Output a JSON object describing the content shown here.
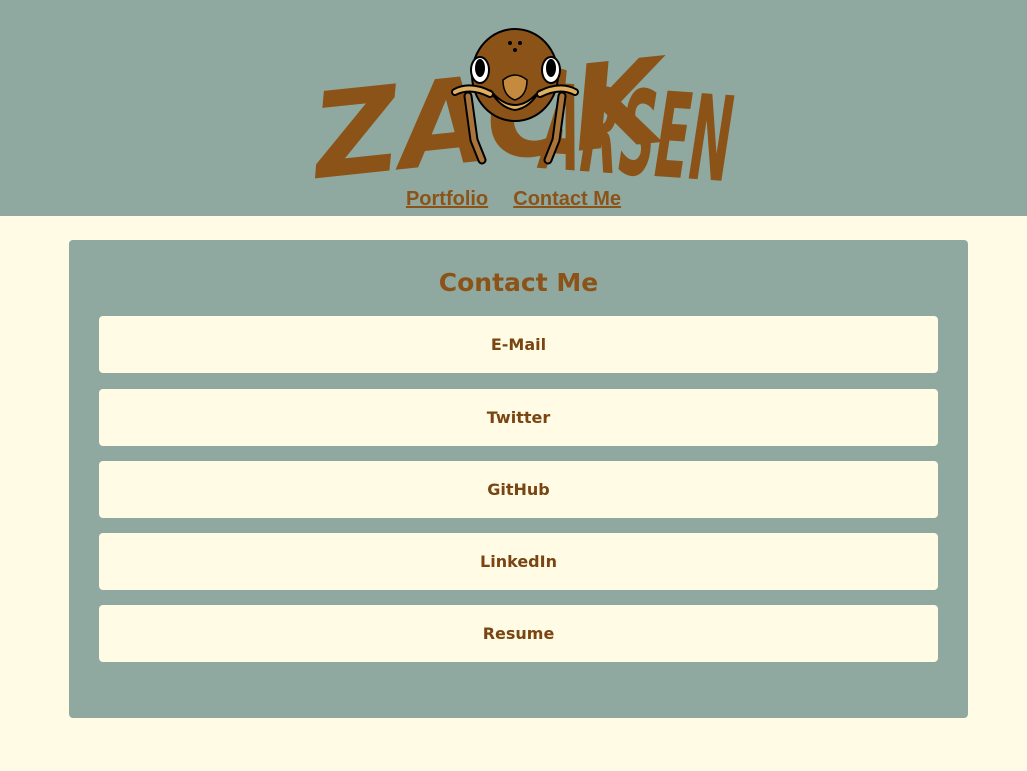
{
  "logo": {
    "text_left": "ZACK",
    "text_right": "ARSEN",
    "mascot": "ant-head-icon"
  },
  "nav": {
    "links": [
      "Portfolio",
      "Contact Me"
    ]
  },
  "contact": {
    "title": "Contact Me",
    "buttons": [
      "E-Mail",
      "Twitter",
      "GitHub",
      "LinkedIn",
      "Resume"
    ]
  },
  "colors": {
    "header_bg": "#8fa9a0",
    "page_bg": "#fffbe4",
    "brand_brown": "#8c5318"
  }
}
